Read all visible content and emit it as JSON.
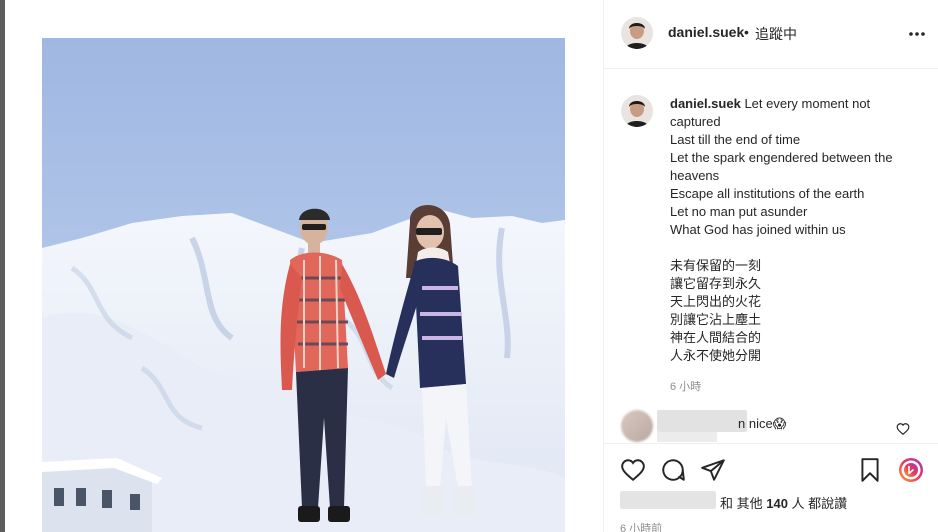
{
  "post": {
    "username": "daniel.suek",
    "follow_dot": "•",
    "follow_status": "追蹤中",
    "caption_lines_en": [
      "Let every moment not",
      "captured",
      "Last till the end of time",
      "Let the spark engendered between the",
      "heavens",
      "Escape all institutions of the earth",
      "Let no man put asunder",
      "What God has joined within us"
    ],
    "caption_lines_zh": [
      "未有保留的一刻",
      "讓它留存到永久",
      "天上閃出的火花",
      "別讓它沾上塵土",
      "神在人間結合的",
      "人永不使她分開"
    ],
    "caption_time": "6 小時",
    "comment": {
      "text": "n nice😱"
    },
    "likes": {
      "prefix": "和 其他 ",
      "count": "140",
      "suffix": " 人 都說讚"
    },
    "posted_ago": "6 小時前"
  },
  "icons": {
    "more": "more-options-icon",
    "like": "heart-icon",
    "comment": "comment-icon",
    "share": "paper-plane-icon",
    "save": "bookmark-icon",
    "app": "instagram-gradient-icon"
  },
  "colors": {
    "text": "#262626",
    "muted": "#8e8e8e",
    "border": "#efefef",
    "sky": "#a9c1e6"
  }
}
